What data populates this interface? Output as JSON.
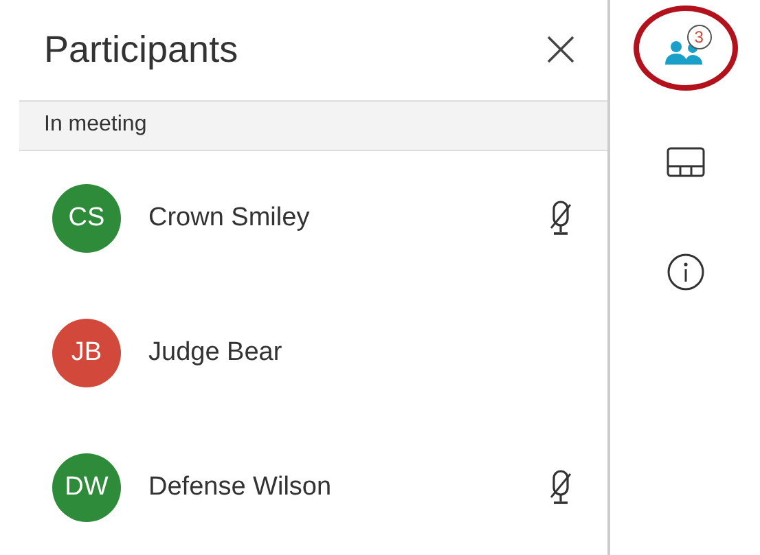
{
  "panel": {
    "title": "Participants"
  },
  "section": {
    "label": "In meeting"
  },
  "participants": [
    {
      "initials": "CS",
      "name": "Crown Smiley",
      "color": "#2e8b3a",
      "muted": true
    },
    {
      "initials": "JB",
      "name": "Judge Bear",
      "color": "#d2483a",
      "muted": false
    },
    {
      "initials": "DW",
      "name": "Defense Wilson",
      "color": "#2e8b3a",
      "muted": true
    }
  ],
  "rail": [
    {
      "kind": "participants",
      "badge": "3",
      "highlighted": true
    },
    {
      "kind": "layout"
    },
    {
      "kind": "info"
    }
  ]
}
